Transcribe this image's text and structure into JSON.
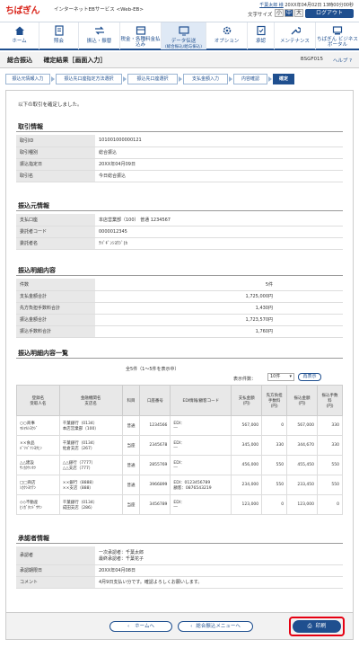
{
  "header": {
    "logo": "ちばぎん",
    "service_name": "インターネットEBサービス <Web-EB>",
    "user_name": "千葉太郎 様",
    "login_time": "20XX年04月02日 13時00分00秒",
    "font_size_label": "文字サイズ",
    "font_sizes": [
      "小",
      "中",
      "大"
    ],
    "logout": "ログアウト"
  },
  "nav": [
    {
      "label": "ホーム",
      "icon": "home-icon"
    },
    {
      "label": "照会",
      "icon": "magnifier-icon"
    },
    {
      "label": "振込・振替",
      "icon": "transfer-icon"
    },
    {
      "label": "税金・各種料金払込み",
      "icon": "tax-icon"
    },
    {
      "label": "データ伝送",
      "sub": "(総合振込/給与振込)",
      "icon": "data-transmission-icon"
    },
    {
      "label": "オプション",
      "icon": "gear-icon"
    },
    {
      "label": "承認",
      "icon": "approval-icon"
    },
    {
      "label": "メンテナンス",
      "icon": "wrench-icon"
    },
    {
      "label": "ちばぎん ビジネスポータル",
      "icon": "portal-icon"
    }
  ],
  "title": {
    "main": "総合振込",
    "sub": "確定結果［画面入力］",
    "screen_id": "BSGF015",
    "help": "ヘルプ"
  },
  "steps": [
    "振込元情報入力",
    "振込先口座指定方法選択",
    "振込先口座選択",
    "支払金額入力",
    "内容確認",
    "確定"
  ],
  "notice": "以下の取引を確定しました。",
  "transaction_info": {
    "title": "取引情報",
    "rows": [
      {
        "k": "取引ID",
        "v": "101001000000121"
      },
      {
        "k": "取引種別",
        "v": "総合振込"
      },
      {
        "k": "振込指定日",
        "v": "20XX年04月09日"
      },
      {
        "k": "取引名",
        "v": "今日総合振込"
      }
    ]
  },
  "source_info": {
    "title": "振込元情報",
    "rows": [
      {
        "k": "支払口座",
        "v": "本店営業部（100） 普通 1234567"
      },
      {
        "k": "委託者コード",
        "v": "0000012345"
      },
      {
        "k": "委託者名",
        "v": "ﾁﾊﾞｷﾞﾝｼﾖｳｼﾞ(ｶ"
      }
    ]
  },
  "detail_info": {
    "title": "振込明細内容",
    "rows": [
      {
        "k": "件数",
        "v": "5件"
      },
      {
        "k": "支払金額合計",
        "v": "1,725,000円"
      },
      {
        "k": "先方負担手数料合計",
        "v": "1,430円"
      },
      {
        "k": "振込金額合計",
        "v": "1,723,570円"
      },
      {
        "k": "振込手数料合計",
        "v": "1,760円"
      }
    ]
  },
  "list": {
    "title": "振込明細内容一覧",
    "count_info": "全5件（1～5件を表示中）",
    "disp_label": "表示件数：",
    "disp_value": "10件",
    "disp_button": "再表示",
    "headers": [
      "登録名\n受取人名",
      "金融機関名\n支店名",
      "科目",
      "口座番号",
      "EDI情報/顧客コード",
      "支払金額\n(円)",
      "先方負担\n手数料\n(円)",
      "振込金額\n(円)",
      "振込手数\n料\n(円)"
    ],
    "rows": [
      {
        "name": "○○商事",
        "kana": "ﾏﾙﾏﾙｼﾖｳｼﾞ",
        "bank": "千葉銀行（0134）",
        "branch": "本店営業部（100）",
        "type": "普通",
        "acct": "1234566",
        "edi": "EDI：\n―",
        "pay": "567,000",
        "fee_other": "0",
        "amount": "567,000",
        "fee": "330"
      },
      {
        "name": "××食品",
        "kana": "ﾊﾞﾂﾊﾞﾂｼﾖｸﾋﾝ",
        "bank": "千葉銀行（0134）",
        "branch": "佐倉支店（267）",
        "type": "当座",
        "acct": "2345678",
        "edi": "EDI：\n―",
        "pay": "345,000",
        "fee_other": "330",
        "amount": "344,670",
        "fee": "330"
      },
      {
        "name": "△△建設",
        "kana": "ｻﾝｶｸｹﾝｾﾂ",
        "bank": "△△銀行（7777）",
        "branch": "△△支店（777）",
        "type": "普通",
        "acct": "2855769",
        "edi": "EDI：\n―",
        "pay": "456,000",
        "fee_other": "550",
        "amount": "455,450",
        "fee": "550"
      },
      {
        "name": "□□商店",
        "kana": "ｼｶｸｼﾖｳﾃﾝ",
        "bank": "××銀行（8888）",
        "branch": "××支店（888）",
        "type": "普通",
        "acct": "3966899",
        "edi": "EDI：0123456789\n顧客：0876543219",
        "pay": "234,000",
        "fee_other": "550",
        "amount": "233,450",
        "fee": "550"
      },
      {
        "name": "◇◇不動産",
        "kana": "ﾋｼｶﾞﾀﾌﾄﾞｳｻﾝ",
        "bank": "千葉銀行（0134）",
        "branch": "成田支店（286）",
        "type": "当座",
        "acct": "3456789",
        "edi": "EDI：\n―",
        "pay": "123,000",
        "fee_other": "0",
        "amount": "123,000",
        "fee": "0"
      }
    ]
  },
  "approver_info": {
    "title": "承認者情報",
    "rows": [
      {
        "k": "承認者",
        "v": "一次承認者：千葉太郎\n最終承認者：千葉花子"
      },
      {
        "k": "承認期限日",
        "v": "20XX年04月08日"
      },
      {
        "k": "コメント",
        "v": "4月9日支払い分です。確認よろしくお願いします。"
      }
    ]
  },
  "buttons": {
    "home": "ホームへ",
    "menu": "総合振込メニューへ",
    "print": "印刷"
  },
  "colors": {
    "brand": "#d9261c",
    "primary": "#1f4f8f",
    "highlight": "#e60012"
  }
}
